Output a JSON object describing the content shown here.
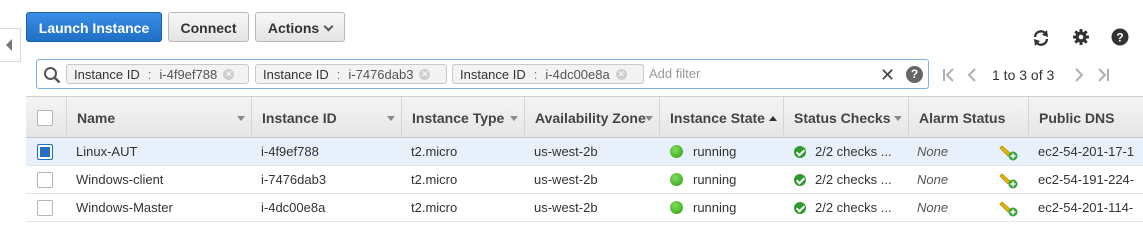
{
  "toolbar": {
    "launch_label": "Launch Instance",
    "connect_label": "Connect",
    "actions_label": "Actions"
  },
  "filter": {
    "chips": [
      {
        "key": "Instance ID",
        "sep": ":",
        "value": "i-4f9ef788"
      },
      {
        "key": "Instance ID",
        "sep": ":",
        "value": "i-7476dab3"
      },
      {
        "key": "Instance ID",
        "sep": ":",
        "value": "i-4dc00e8a"
      }
    ],
    "placeholder": "Add filter",
    "help": "?"
  },
  "pagination": {
    "text": "1 to 3 of 3"
  },
  "table": {
    "columns": [
      "Name",
      "Instance ID",
      "Instance Type",
      "Availability Zone",
      "Instance State",
      "Status Checks",
      "Alarm Status",
      "Public DNS"
    ],
    "sorted_column": "Instance State",
    "rows": [
      {
        "selected": true,
        "name": "Linux-AUT",
        "id": "i-4f9ef788",
        "type": "t2.micro",
        "zone": "us-west-2b",
        "state": "running",
        "checks": "2/2 checks ...",
        "alarm": "None",
        "dns": "ec2-54-201-17-1"
      },
      {
        "selected": false,
        "name": "Windows-client",
        "id": "i-7476dab3",
        "type": "t2.micro",
        "zone": "us-west-2b",
        "state": "running",
        "checks": "2/2 checks ...",
        "alarm": "None",
        "dns": "ec2-54-191-224-"
      },
      {
        "selected": false,
        "name": "Windows-Master",
        "id": "i-4dc00e8a",
        "type": "t2.micro",
        "zone": "us-west-2b",
        "state": "running",
        "checks": "2/2 checks ...",
        "alarm": "None",
        "dns": "ec2-54-201-114-"
      }
    ]
  },
  "icons": {
    "top": [
      "refresh-icon",
      "gear-icon",
      "help-icon"
    ],
    "pager": [
      "first-page-icon",
      "prev-page-icon",
      "next-page-icon",
      "last-page-icon"
    ]
  },
  "colors": {
    "primary": "#1f6fc5",
    "running": "#2f9a14",
    "selected_row": "#e8f1fb"
  }
}
